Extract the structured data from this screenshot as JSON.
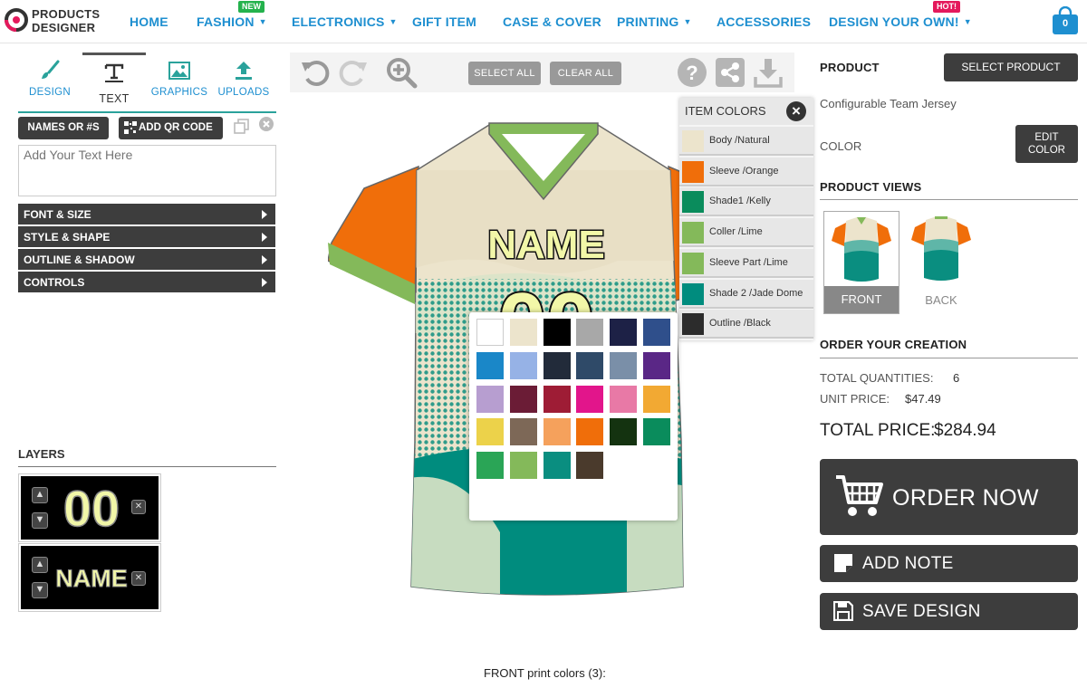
{
  "logo": {
    "line1": "PRODUCTS",
    "line2": "DESIGNER"
  },
  "nav": {
    "home": "HOME",
    "fashion": "FASHION",
    "fashion_badge": "NEW",
    "electronics": "ELECTRONICS",
    "gift": "GIFT ITEM",
    "case": "CASE & COVER",
    "printing": "PRINTING",
    "accessories": "ACCESSORIES",
    "design": "DESIGN YOUR OWN!",
    "design_badge": "HOT!",
    "cart_count": "0"
  },
  "tools": {
    "design": "DESIGN",
    "text": "TEXT",
    "graphics": "GRAPHICS",
    "uploads": "UPLOADS"
  },
  "text_panel": {
    "names_btn": "NAMES OR #S",
    "qr_btn": "ADD QR CODE",
    "placeholder": "Add Your Text Here",
    "accordion": [
      "FONT & SIZE",
      "STYLE & SHAPE",
      "OUTLINE & SHADOW",
      "CONTROLS"
    ]
  },
  "layers": {
    "title": "LAYERS",
    "items": [
      "00",
      "NAME"
    ]
  },
  "canvas": {
    "select_all": "SELECT ALL",
    "clear_all": "CLEAR ALL",
    "jersey_name": "NAME",
    "jersey_number": "00"
  },
  "item_colors": {
    "title": "ITEM COLORS",
    "rows": [
      {
        "label": "Body  /Natural",
        "color": "#ece4cc"
      },
      {
        "label": "Sleeve   /Orange",
        "color": "#f06e0a"
      },
      {
        "label": "Shade1   /Kelly",
        "color": "#0a8c5c"
      },
      {
        "label": "Coller   /Lime",
        "color": "#84b95a"
      },
      {
        "label": "Sleeve Part   /Lime",
        "color": "#84b95a"
      },
      {
        "label": "Shade 2   /Jade Dome",
        "color": "#008c7e"
      },
      {
        "label": "Outline   /Black",
        "color": "#2c2c2c"
      }
    ]
  },
  "palette": {
    "colors": [
      "#ffffff",
      "#ece4cc",
      "#000000",
      "#a8a8a8",
      "#1d2146",
      "#2f4f8b",
      "#1a87c8",
      "#96b2e6",
      "#222b3a",
      "#2f4a68",
      "#7a8fa8",
      "#5a2786",
      "#b79ed0",
      "#6b1c36",
      "#9e1c35",
      "#e2158b",
      "#e879a6",
      "#f2a933",
      "#ecd24a",
      "#7d6857",
      "#f5a15c",
      "#f06e0a",
      "#143310",
      "#0a8c5c",
      "#2aa556",
      "#84b95a",
      "#0a8e80",
      "#4a3a2c"
    ]
  },
  "right": {
    "product_title": "PRODUCT",
    "select_product": "SELECT PRODUCT",
    "product_name": "Configurable Team Jersey",
    "color_label": "COLOR",
    "edit_color": "EDIT COLOR",
    "views_title": "PRODUCT VIEWS",
    "front": "FRONT",
    "back": "BACK",
    "order_title": "ORDER YOUR CREATION",
    "total_qty_label": "TOTAL QUANTITIES:",
    "total_qty": "6",
    "unit_price_label": "UNIT PRICE:",
    "unit_price": "$47.49",
    "total_price_label": "TOTAL PRICE:",
    "total_price": "$284.94",
    "order_now": "ORDER NOW",
    "add_note": "ADD NOTE",
    "save_design": "SAVE DESIGN"
  },
  "footer": {
    "print_colors": "FRONT print colors  (3):"
  }
}
